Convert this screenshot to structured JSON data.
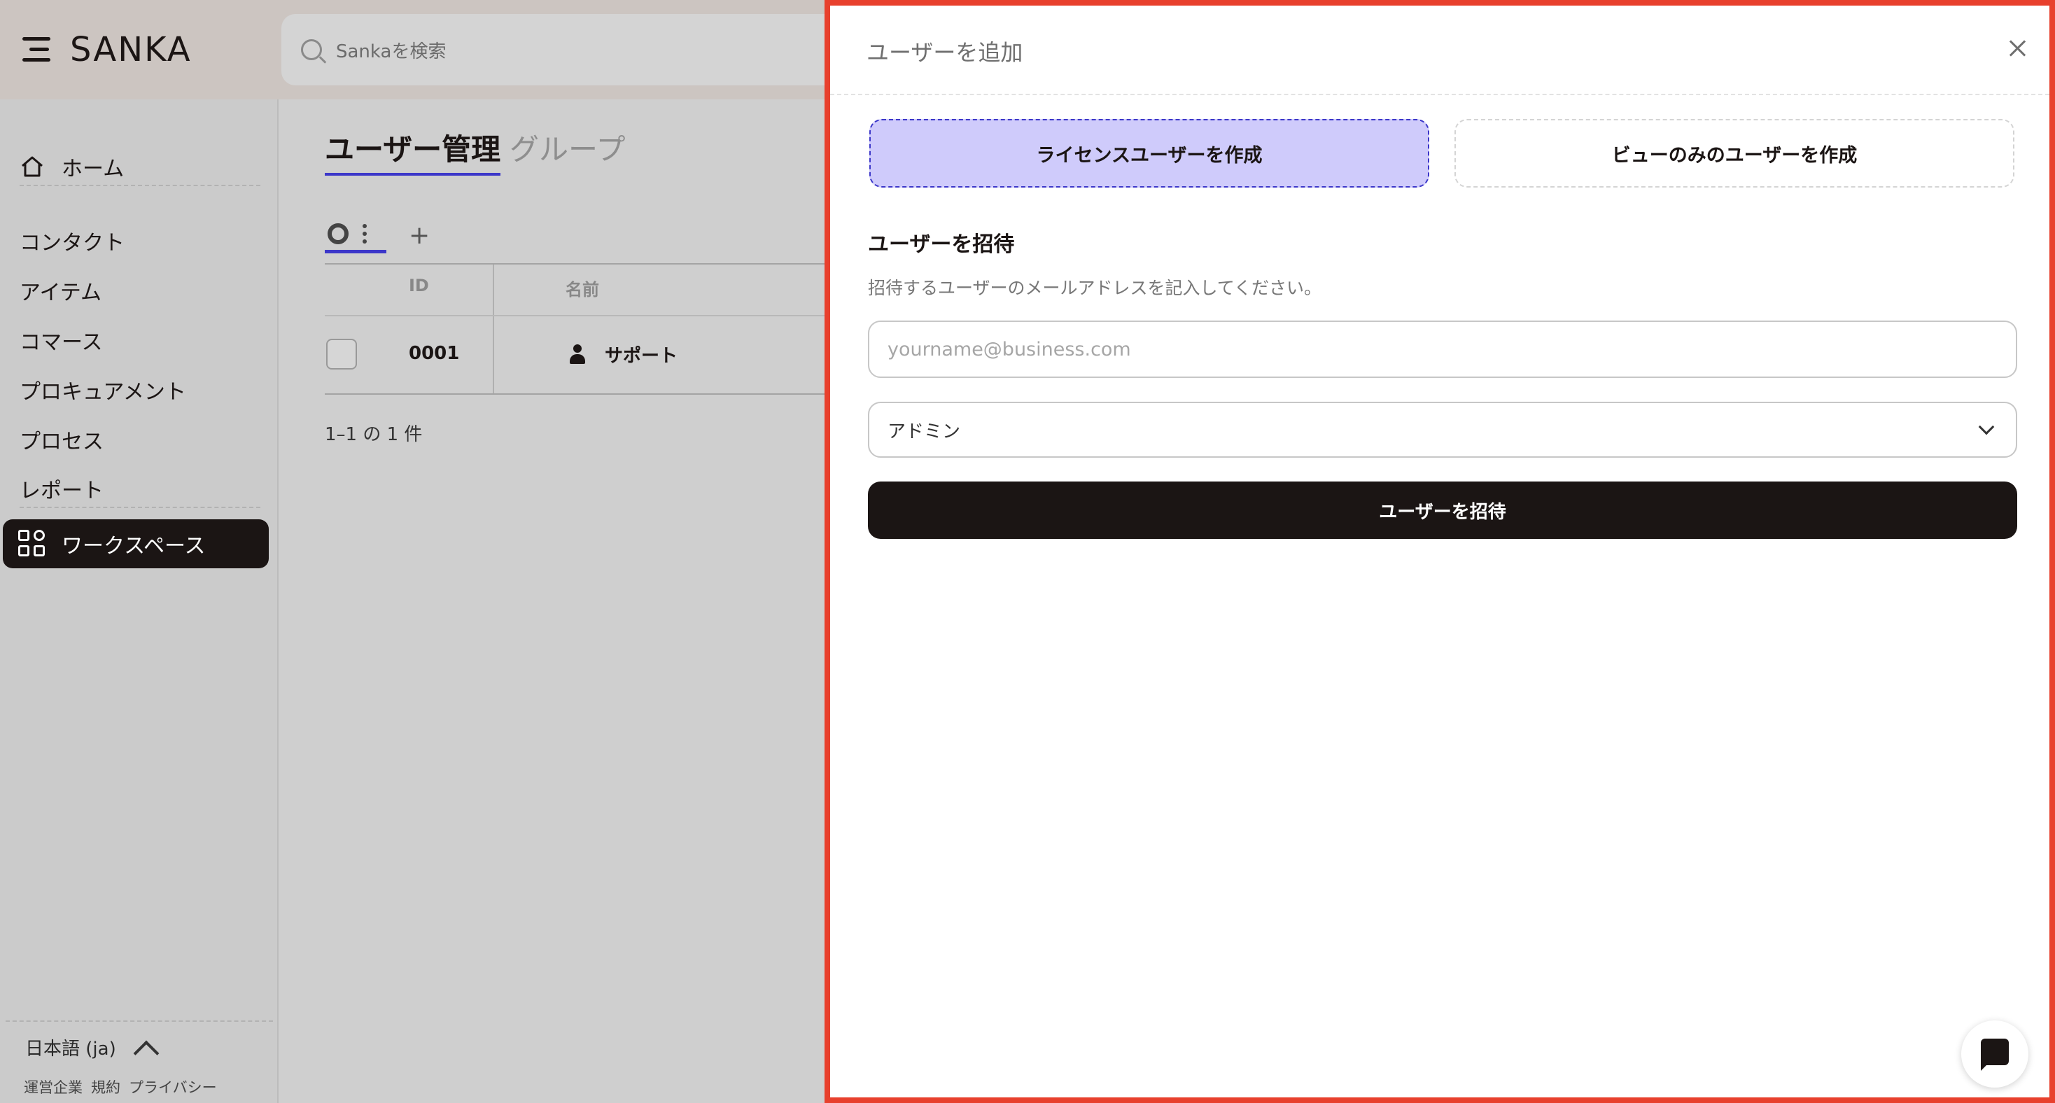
{
  "app": {
    "brand": "SANKA"
  },
  "search": {
    "placeholder": "Sankaを検索"
  },
  "sidebar": {
    "home": "ホーム",
    "items": [
      "コンタクト",
      "アイテム",
      "コマース",
      "プロキュアメント",
      "プロセス",
      "レポート"
    ],
    "workspace": "ワークスペース",
    "language": "日本語 (ja)",
    "footer_links": [
      "運営企業",
      "規約",
      "プライバシー"
    ]
  },
  "main": {
    "tabs": [
      "ユーザー管理",
      "グループ"
    ],
    "table": {
      "headers": [
        "ID",
        "名前"
      ],
      "rows": [
        {
          "id": "0001",
          "name": "サポート"
        }
      ]
    },
    "pagination": "1–1 の 1 件"
  },
  "modal": {
    "title": "ユーザーを追加",
    "user_types": [
      "ライセンスユーザーを作成",
      "ビューのみのユーザーを作成"
    ],
    "selected_user_type": "ライセンスユーザーを作成",
    "section_title": "ユーザーを招待",
    "description": "招待するユーザーのメールアドレスを記入してください。",
    "email": {
      "value": "",
      "placeholder": "yourname@business.com"
    },
    "role": {
      "selected": "アドミン"
    },
    "invite_button": "ユーザーを招待"
  },
  "colors": {
    "accent": "#3c37c9",
    "active_type_bg": "#cfcbfb",
    "primary_button": "#1b1514",
    "modal_border": "#e8402d"
  }
}
